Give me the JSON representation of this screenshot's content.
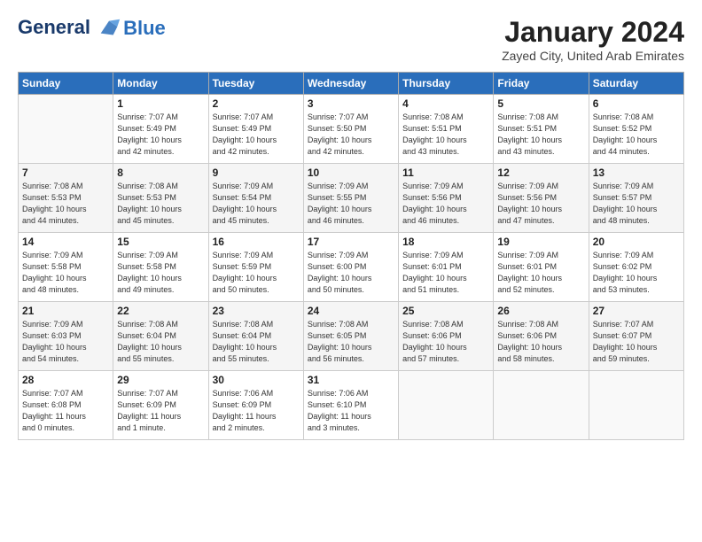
{
  "header": {
    "logo_line1": "General",
    "logo_line2": "Blue",
    "month_title": "January 2024",
    "subtitle": "Zayed City, United Arab Emirates"
  },
  "days_of_week": [
    "Sunday",
    "Monday",
    "Tuesday",
    "Wednesday",
    "Thursday",
    "Friday",
    "Saturday"
  ],
  "weeks": [
    [
      {
        "day": "",
        "content": ""
      },
      {
        "day": "1",
        "content": "Sunrise: 7:07 AM\nSunset: 5:49 PM\nDaylight: 10 hours\nand 42 minutes."
      },
      {
        "day": "2",
        "content": "Sunrise: 7:07 AM\nSunset: 5:49 PM\nDaylight: 10 hours\nand 42 minutes."
      },
      {
        "day": "3",
        "content": "Sunrise: 7:07 AM\nSunset: 5:50 PM\nDaylight: 10 hours\nand 42 minutes."
      },
      {
        "day": "4",
        "content": "Sunrise: 7:08 AM\nSunset: 5:51 PM\nDaylight: 10 hours\nand 43 minutes."
      },
      {
        "day": "5",
        "content": "Sunrise: 7:08 AM\nSunset: 5:51 PM\nDaylight: 10 hours\nand 43 minutes."
      },
      {
        "day": "6",
        "content": "Sunrise: 7:08 AM\nSunset: 5:52 PM\nDaylight: 10 hours\nand 44 minutes."
      }
    ],
    [
      {
        "day": "7",
        "content": "Sunrise: 7:08 AM\nSunset: 5:53 PM\nDaylight: 10 hours\nand 44 minutes."
      },
      {
        "day": "8",
        "content": "Sunrise: 7:08 AM\nSunset: 5:53 PM\nDaylight: 10 hours\nand 45 minutes."
      },
      {
        "day": "9",
        "content": "Sunrise: 7:09 AM\nSunset: 5:54 PM\nDaylight: 10 hours\nand 45 minutes."
      },
      {
        "day": "10",
        "content": "Sunrise: 7:09 AM\nSunset: 5:55 PM\nDaylight: 10 hours\nand 46 minutes."
      },
      {
        "day": "11",
        "content": "Sunrise: 7:09 AM\nSunset: 5:56 PM\nDaylight: 10 hours\nand 46 minutes."
      },
      {
        "day": "12",
        "content": "Sunrise: 7:09 AM\nSunset: 5:56 PM\nDaylight: 10 hours\nand 47 minutes."
      },
      {
        "day": "13",
        "content": "Sunrise: 7:09 AM\nSunset: 5:57 PM\nDaylight: 10 hours\nand 48 minutes."
      }
    ],
    [
      {
        "day": "14",
        "content": "Sunrise: 7:09 AM\nSunset: 5:58 PM\nDaylight: 10 hours\nand 48 minutes."
      },
      {
        "day": "15",
        "content": "Sunrise: 7:09 AM\nSunset: 5:58 PM\nDaylight: 10 hours\nand 49 minutes."
      },
      {
        "day": "16",
        "content": "Sunrise: 7:09 AM\nSunset: 5:59 PM\nDaylight: 10 hours\nand 50 minutes."
      },
      {
        "day": "17",
        "content": "Sunrise: 7:09 AM\nSunset: 6:00 PM\nDaylight: 10 hours\nand 50 minutes."
      },
      {
        "day": "18",
        "content": "Sunrise: 7:09 AM\nSunset: 6:01 PM\nDaylight: 10 hours\nand 51 minutes."
      },
      {
        "day": "19",
        "content": "Sunrise: 7:09 AM\nSunset: 6:01 PM\nDaylight: 10 hours\nand 52 minutes."
      },
      {
        "day": "20",
        "content": "Sunrise: 7:09 AM\nSunset: 6:02 PM\nDaylight: 10 hours\nand 53 minutes."
      }
    ],
    [
      {
        "day": "21",
        "content": "Sunrise: 7:09 AM\nSunset: 6:03 PM\nDaylight: 10 hours\nand 54 minutes."
      },
      {
        "day": "22",
        "content": "Sunrise: 7:08 AM\nSunset: 6:04 PM\nDaylight: 10 hours\nand 55 minutes."
      },
      {
        "day": "23",
        "content": "Sunrise: 7:08 AM\nSunset: 6:04 PM\nDaylight: 10 hours\nand 55 minutes."
      },
      {
        "day": "24",
        "content": "Sunrise: 7:08 AM\nSunset: 6:05 PM\nDaylight: 10 hours\nand 56 minutes."
      },
      {
        "day": "25",
        "content": "Sunrise: 7:08 AM\nSunset: 6:06 PM\nDaylight: 10 hours\nand 57 minutes."
      },
      {
        "day": "26",
        "content": "Sunrise: 7:08 AM\nSunset: 6:06 PM\nDaylight: 10 hours\nand 58 minutes."
      },
      {
        "day": "27",
        "content": "Sunrise: 7:07 AM\nSunset: 6:07 PM\nDaylight: 10 hours\nand 59 minutes."
      }
    ],
    [
      {
        "day": "28",
        "content": "Sunrise: 7:07 AM\nSunset: 6:08 PM\nDaylight: 11 hours\nand 0 minutes."
      },
      {
        "day": "29",
        "content": "Sunrise: 7:07 AM\nSunset: 6:09 PM\nDaylight: 11 hours\nand 1 minute."
      },
      {
        "day": "30",
        "content": "Sunrise: 7:06 AM\nSunset: 6:09 PM\nDaylight: 11 hours\nand 2 minutes."
      },
      {
        "day": "31",
        "content": "Sunrise: 7:06 AM\nSunset: 6:10 PM\nDaylight: 11 hours\nand 3 minutes."
      },
      {
        "day": "",
        "content": ""
      },
      {
        "day": "",
        "content": ""
      },
      {
        "day": "",
        "content": ""
      }
    ]
  ]
}
